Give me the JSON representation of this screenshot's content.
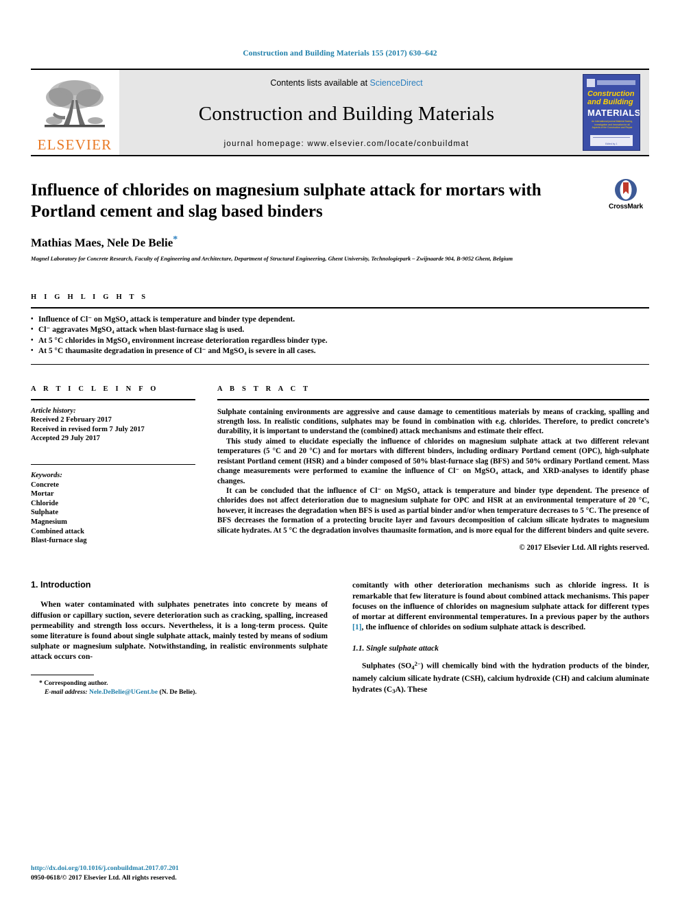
{
  "running_head": "Construction and Building Materials 155 (2017) 630–642",
  "masthead": {
    "contents_prefix": "Contents lists available at ",
    "sciencedirect": "ScienceDirect",
    "journal_title": "Construction and Building Materials",
    "homepage": "journal homepage: www.elsevier.com/locate/conbuildmat",
    "publisher_logo_text": "ELSEVIER",
    "publisher_logo_icon": "elsevier-tree-icon",
    "cover": {
      "line1": "Construction",
      "line2": "and Building",
      "line3": "MATERIALS",
      "subtitle": "An international journal Material Saving, Investigation and Innovation for all Aspects of the Construction and Repair",
      "footer": "Edited by J."
    }
  },
  "article": {
    "title": "Influence of chlorides on magnesium sulphate attack for mortars with Portland cement and slag based binders",
    "authors": "Mathias Maes, Nele De Belie",
    "corresponding_marker": "*",
    "affiliation": "Magnel Laboratory for Concrete Research, Faculty of Engineering and Architecture, Department of Structural Engineering, Ghent University, Technologiepark – Zwijnaarde 904, B-9052 Ghent, Belgium",
    "crossmark_label": "CrossMark"
  },
  "highlights": {
    "heading": "H I G H L I G H T S",
    "items": [
      "Influence of Cl⁻ on MgSO₄ attack is temperature and binder type dependent.",
      "Cl⁻ aggravates MgSO₄ attack when blast-furnace slag is used.",
      "At 5 °C chlorides in MgSO₄ environment increase deterioration regardless binder type.",
      "At 5 °C thaumasite degradation in presence of Cl⁻ and MgSO₄ is severe in all cases."
    ]
  },
  "article_info": {
    "heading": "A R T I C L E  I N F O",
    "history_label": "Article history:",
    "history": [
      "Received 2 February 2017",
      "Received in revised form 7 July 2017",
      "Accepted 29 July 2017"
    ],
    "keywords_label": "Keywords:",
    "keywords": [
      "Concrete",
      "Mortar",
      "Chloride",
      "Sulphate",
      "Magnesium",
      "Combined attack",
      "Blast-furnace slag"
    ]
  },
  "abstract": {
    "heading": "A B S T R A C T",
    "paragraphs": [
      "Sulphate containing environments are aggressive and cause damage to cementitious materials by means of cracking, spalling and strength loss. In realistic conditions, sulphates may be found in combination with e.g. chlorides. Therefore, to predict concrete’s durability, it is important to understand the (combined) attack mechanisms and estimate their effect.",
      "This study aimed to elucidate especially the influence of chlorides on magnesium sulphate attack at two different relevant temperatures (5 °C and 20 °C) and for mortars with different binders, including ordinary Portland cement (OPC), high-sulphate resistant Portland cement (HSR) and a binder composed of 50% blast-furnace slag (BFS) and 50% ordinary Portland cement. Mass change measurements were performed to examine the influence of Cl⁻ on MgSO₄ attack, and XRD-analyses to identify phase changes.",
      "It can be concluded that the influence of Cl⁻ on MgSO₄ attack is temperature and binder type dependent. The presence of chlorides does not affect deterioration due to magnesium sulphate for OPC and HSR at an environmental temperature of 20 °C, however, it increases the degradation when BFS is used as partial binder and/or when temperature decreases to 5 °C. The presence of BFS decreases the formation of a protecting brucite layer and favours decomposition of calcium silicate hydrates to magnesium silicate hydrates. At 5 °C the degradation involves thaumasite formation, and is more equal for the different binders and quite severe."
    ],
    "copyright": "© 2017 Elsevier Ltd. All rights reserved."
  },
  "body": {
    "section_1_title": "1. Introduction",
    "left_paragraph": "When water contaminated with sulphates penetrates into concrete by means of diffusion or capillary suction, severe deterioration such as cracking, spalling, increased permeability and strength loss occurs. Nevertheless, it is a long-term process. Quite some literature is found about single sulphate attack, mainly tested by means of sodium sulphate or magnesium sulphate. Notwithstanding, in realistic environments sulphate attack occurs con-",
    "right_paragraph_part1": "comitantly with other deterioration mechanisms such as chloride ingress. It is remarkable that few literature is found about combined attack mechanisms. This paper focuses on the influence of chlorides on magnesium sulphate attack for different types of mortar at different environmental temperatures. In a previous paper by the authors ",
    "citation_1": "[1]",
    "right_paragraph_part2": ", the influence of chlorides on sodium sulphate attack is described.",
    "section_1_1_title": "1.1. Single sulphate attack",
    "right_paragraph_2_a": "Sulphates (SO",
    "right_paragraph_2_b": ") will chemically bind with the hydration products of the binder, namely calcium silicate hydrate (CSH), calcium hydroxide (CH) and calcium aluminate hydrates (C",
    "right_paragraph_2_c": "A). These"
  },
  "footnote": {
    "corresponding_marker": "*",
    "corresponding_text": "Corresponding author.",
    "email_label": "E-mail address:",
    "email": "Nele.DeBelie@UGent.be",
    "email_suffix": "(N. De Belie)."
  },
  "page_footer": {
    "doi": "http://dx.doi.org/10.1016/j.conbuildmat.2017.07.201",
    "issn_line": "0950-0618/© 2017 Elsevier Ltd. All rights reserved."
  },
  "colors": {
    "link": "#1f7faa",
    "sciencedirect": "#2a7fbf",
    "elsevier_orange": "#E87722",
    "cover_blue": "#3c4fa8"
  }
}
